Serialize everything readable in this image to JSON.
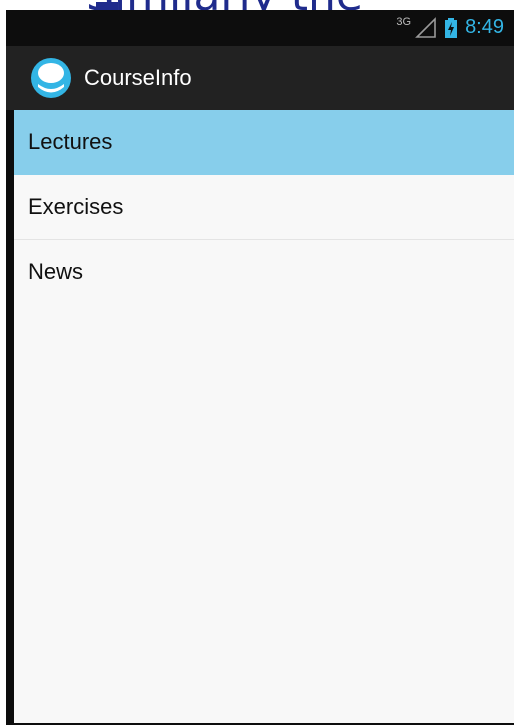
{
  "slide": {
    "overlay_text": "Similarly the"
  },
  "status_bar": {
    "network": "3G",
    "time": "8:49",
    "icons": [
      "signal-icon",
      "battery-charging-icon"
    ],
    "accent_color": "#33b5e5"
  },
  "action_bar": {
    "title": "CourseInfo",
    "icon": "app-logo-icon"
  },
  "list": {
    "items": [
      {
        "label": "Lectures",
        "selected": true
      },
      {
        "label": "Exercises",
        "selected": false
      },
      {
        "label": "News",
        "selected": false
      }
    ],
    "selected_color": "#87ceeb"
  }
}
